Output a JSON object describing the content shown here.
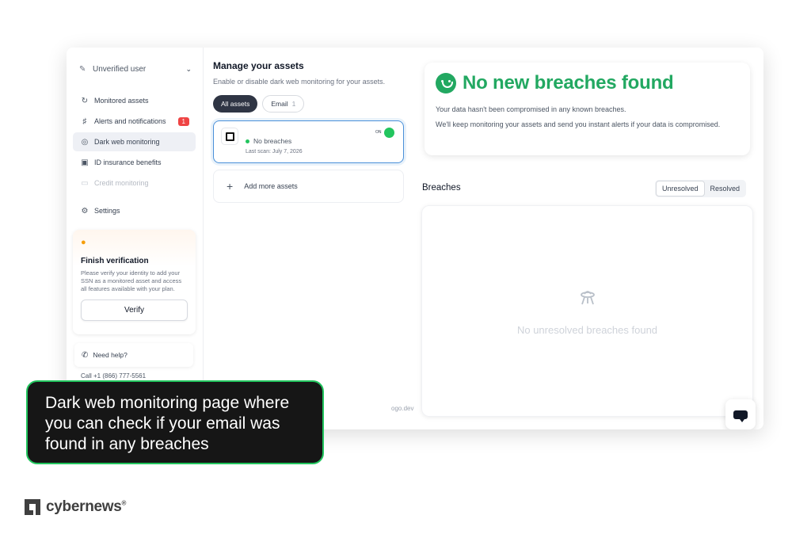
{
  "sidebar": {
    "user_label": "Unverified user",
    "nav": [
      {
        "label": "Monitored assets",
        "icon": "monitor-icon"
      },
      {
        "label": "Alerts and notifications",
        "icon": "bell-icon",
        "badge": "1"
      },
      {
        "label": "Dark web monitoring",
        "icon": "radar-icon",
        "active": true
      },
      {
        "label": "ID insurance benefits",
        "icon": "gift-icon"
      },
      {
        "label": "Credit monitoring",
        "icon": "card-icon",
        "disabled": true
      }
    ],
    "settings_label": "Settings",
    "verification": {
      "title": "Finish verification",
      "text": "Please verify your identity to add your SSN as a monitored asset and access all features available with your plan.",
      "button": "Verify"
    },
    "help_label": "Need help?",
    "call_label": "Call +1 (866) 777-5561"
  },
  "assets": {
    "title": "Manage your assets",
    "subtitle": "Enable or disable dark web monitoring for your assets.",
    "tabs": [
      {
        "label": "All assets",
        "active": true
      },
      {
        "label": "Email",
        "count": "1"
      }
    ],
    "card": {
      "toggle_label": "ON",
      "status": "No breaches",
      "last_scan": "Last scan: July 7, 2026"
    },
    "add_label": "Add more assets",
    "logo_credit": "ogo.dev"
  },
  "status": {
    "title": "No new breaches found",
    "line1": "Your data hasn't been compromised in any known breaches.",
    "line2": "We'll keep monitoring your assets and send you instant alerts if your data is compromised.",
    "accent_color": "#22a861"
  },
  "breaches": {
    "title": "Breaches",
    "segments": [
      "Unresolved",
      "Resolved"
    ],
    "empty_text": "No unresolved breaches found"
  },
  "callout": {
    "text": "Dark web monitoring page where you can check if your email was found in any breaches"
  },
  "brand": {
    "name": "cybernews",
    "mark": "®"
  }
}
